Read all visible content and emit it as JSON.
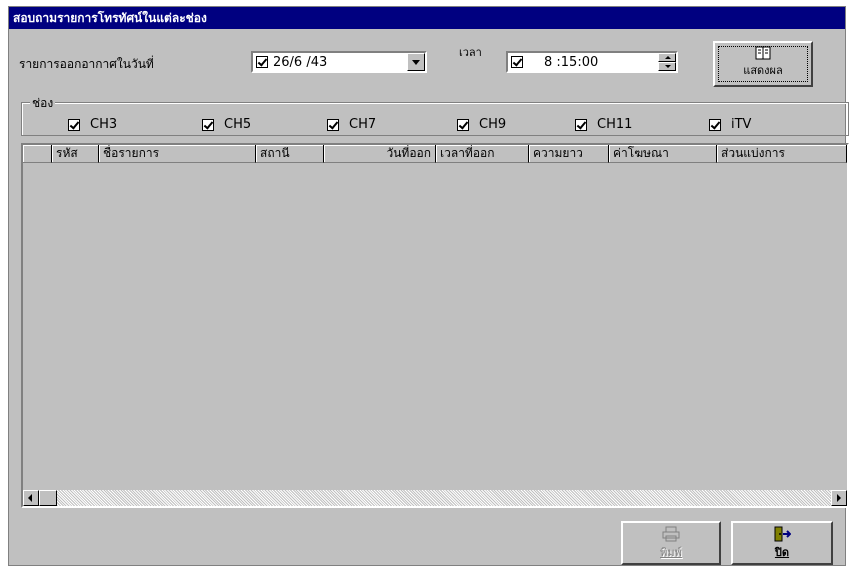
{
  "window": {
    "title": "สอบถามรายการโทรทัศน์ในแต่ละช่อง"
  },
  "date_filter": {
    "label": "รายการออกอากาศในวันที่",
    "value": "26/6 /43",
    "checked": true
  },
  "time_filter": {
    "label": "เวลา",
    "value": "8 :15:00",
    "checked": true
  },
  "show_button": {
    "label": "แสดงผล",
    "icon": "book-icon"
  },
  "channels": {
    "label": "ช่อง",
    "items": [
      {
        "name": "CH3",
        "checked": true
      },
      {
        "name": "CH5",
        "checked": true
      },
      {
        "name": "CH7",
        "checked": true
      },
      {
        "name": "CH9",
        "checked": true
      },
      {
        "name": "CH11",
        "checked": true
      },
      {
        "name": "iTV",
        "checked": true
      }
    ]
  },
  "table": {
    "columns": [
      "",
      "รหัส",
      "ชื่อรายการ",
      "สถานี",
      "วันที่ออก",
      "เวลาที่ออก",
      "ความยาว",
      "ค่าโฆษณา",
      "ส่วนแบ่งการ"
    ],
    "rows": []
  },
  "print_button": {
    "label": "พิมพ์",
    "icon": "printer-icon",
    "enabled": false
  },
  "close_button": {
    "label": "ปิด",
    "icon": "exit-door-icon"
  },
  "colors": {
    "title_bg": "#000080",
    "face": "#c0c0c0"
  }
}
